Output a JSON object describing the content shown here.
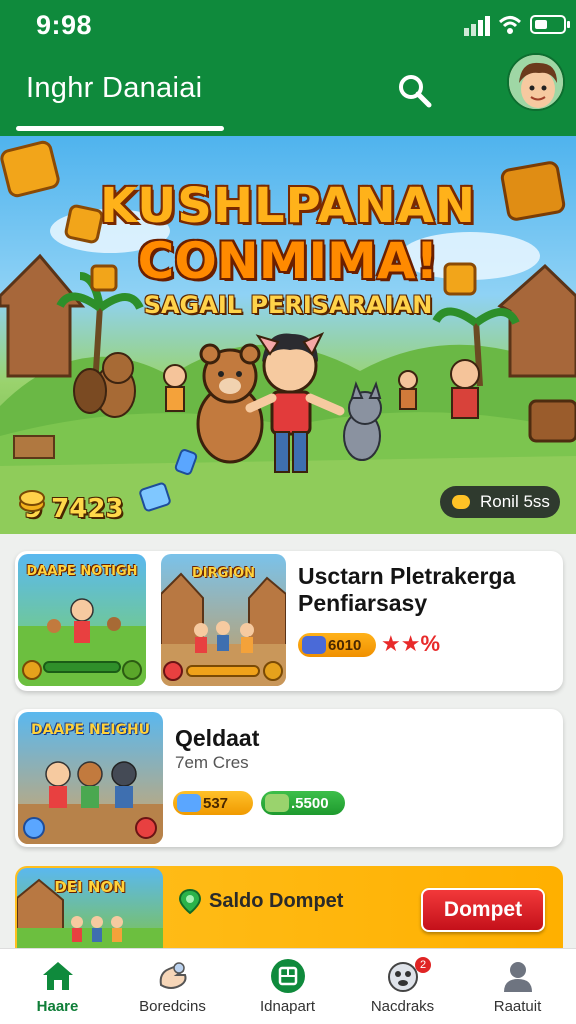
{
  "status_bar": {
    "time": "9:98"
  },
  "header": {
    "title": "Inghr Danaiai"
  },
  "banner": {
    "headline_line1": "KUSHLPANAN",
    "headline_line2": "CONMIMA!",
    "subheadline": "SAGAIL PERISARAIAN",
    "coins": "9 7423",
    "round_label": "Ronil 5ss"
  },
  "card1": {
    "thumb1_title": "DAAPE NOTIGH",
    "thumb2_title": "DIRGION",
    "title": "Usctarn Pletrakerga Penfiarsasy",
    "points": "6010",
    "rating": "★★%"
  },
  "card2": {
    "thumb_title": "DAAPE NEIGHU",
    "title": "Qeldaat",
    "subtitle": "7em Cres",
    "stat1": "537",
    "stat2": ".5500"
  },
  "promo": {
    "thumb_title": "DEI NON",
    "saldo_label": "Saldo Dompet",
    "button_label": "Dompet"
  },
  "bottom_nav": [
    {
      "label": "Haare",
      "active": true
    },
    {
      "label": "Boredcins",
      "active": false
    },
    {
      "label": "Idnapart",
      "active": false
    },
    {
      "label": "Nacdraks",
      "active": false,
      "badge": "2"
    },
    {
      "label": "Raatuit",
      "active": false
    }
  ],
  "colors": {
    "primary": "#0f8a3c",
    "accent": "#ffb000",
    "danger": "#e02424"
  }
}
